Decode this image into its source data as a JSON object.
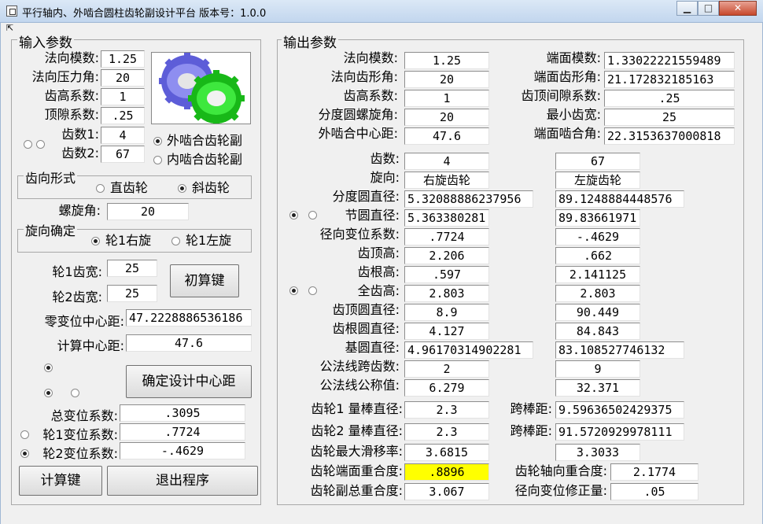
{
  "window": {
    "title": "平行轴内、外啮合圆柱齿轮副设计平台 版本号：1.0.0",
    "buttons": {
      "minimize": "▁",
      "maximize": "□",
      "close": "✕"
    }
  },
  "input": {
    "legend": "输入参数",
    "normal_module": {
      "label": "法向模数:",
      "value": "1.25"
    },
    "pressure_angle": {
      "label": "法向压力角:",
      "value": "20"
    },
    "addendum_coef": {
      "label": "齿高系数:",
      "value": "1"
    },
    "clearance_coef": {
      "label": "顶隙系数:",
      "value": ".25"
    },
    "teeth1": {
      "label": "齿数1:",
      "value": "4"
    },
    "teeth2": {
      "label": "齿数2:",
      "value": "67"
    },
    "mesh_external": "外啮合齿轮副",
    "mesh_internal": "内啮合齿轮副",
    "tooth_form_legend": "齿向形式",
    "spur": "直齿轮",
    "helical": "斜齿轮",
    "helix_angle": {
      "label": "螺旋角:",
      "value": "20"
    },
    "hand_legend": "旋向确定",
    "right_hand": "轮1右旋",
    "left_hand": "轮1左旋",
    "width1": {
      "label": "轮1齿宽:",
      "value": "25"
    },
    "width2": {
      "label": "轮2齿宽:",
      "value": "25"
    },
    "initial_button": "初算键",
    "zero_center": {
      "label": "零变位中心距:",
      "value": "47.2228886536186"
    },
    "calc_center": {
      "label": "计算中心距:",
      "value": "47.6"
    },
    "confirm_button": "确定设计中心距",
    "total_shift": {
      "label": "总变位系数:",
      "value": ".3095"
    },
    "shift1": {
      "label": "轮1变位系数:",
      "value": ".7724"
    },
    "shift2": {
      "label": "轮2变位系数:",
      "value": "-.4629"
    },
    "compute_button": "计算键",
    "exit_button": "退出程序"
  },
  "output": {
    "legend": "输出参数",
    "normal_module": {
      "label": "法向模数:",
      "value": "1.25"
    },
    "normal_profile_angle": {
      "label": "法向齿形角:",
      "value": "20"
    },
    "addendum_coef": {
      "label": "齿高系数:",
      "value": "1"
    },
    "helix_angle": {
      "label": "分度圆螺旋角:",
      "value": "20"
    },
    "center_distance": {
      "label": "外啮合中心距:",
      "value": "47.6"
    },
    "transverse_module": {
      "label": "端面模数:",
      "value": "1.33022221559489"
    },
    "transverse_profile_angle": {
      "label": "端面齿形角:",
      "value": "21.172832185163"
    },
    "tip_clearance_coef": {
      "label": "齿顶间隙系数:",
      "value": ".25"
    },
    "min_width": {
      "label": "最小齿宽:",
      "value": "25"
    },
    "transverse_mesh_angle": {
      "label": "端面啮合角:",
      "value": "22.3153637000818"
    },
    "rows": [
      {
        "label": "齿数:",
        "g1": "4",
        "g2": "67"
      },
      {
        "label": "旋向:",
        "g1": "右旋齿轮",
        "g2": "左旋齿轮"
      },
      {
        "label": "分度圆直径:",
        "g1": "5.32088886237956",
        "g2": "89.1248884448576"
      },
      {
        "label": "节圆直径:",
        "g1": "5.363380281",
        "g2": "89.83661971"
      },
      {
        "label": "径向变位系数:",
        "g1": ".7724",
        "g2": "-.4629"
      },
      {
        "label": "齿顶高:",
        "g1": "2.206",
        "g2": ".662"
      },
      {
        "label": "齿根高:",
        "g1": ".597",
        "g2": "2.141125"
      },
      {
        "label": "全齿高:",
        "g1": "2.803",
        "g2": "2.803"
      },
      {
        "label": "齿顶圆直径:",
        "g1": "8.9",
        "g2": "90.449"
      },
      {
        "label": "齿根圆直径:",
        "g1": "4.127",
        "g2": "84.843"
      },
      {
        "label": "基圆直径:",
        "g1": "4.96170314902281",
        "g2": "83.108527746132"
      },
      {
        "label": "公法线跨齿数:",
        "g1": "2",
        "g2": "9"
      },
      {
        "label": "公法线公称值:",
        "g1": "6.279",
        "g2": "32.371"
      }
    ],
    "gear1_pin": {
      "label": "齿轮1 量棒直径:",
      "value": "2.3"
    },
    "gear1_over_pins": {
      "label": "跨棒距:",
      "value": "9.59636502429375"
    },
    "gear2_pin": {
      "label": "齿轮2 量棒直径:",
      "value": "2.3"
    },
    "gear2_over_pins": {
      "label": "跨棒距:",
      "value": "91.5720929978111"
    },
    "max_slide": {
      "label": "齿轮最大滑移率:",
      "g1": "3.6815",
      "g2": "3.3033"
    },
    "transverse_contact": {
      "label": "齿轮端面重合度:",
      "value": ".8896"
    },
    "axial_contact": {
      "label": "齿轮轴向重合度:",
      "value": "2.1774"
    },
    "total_contact": {
      "label": "齿轮副总重合度:",
      "value": "3.067"
    },
    "radial_shift_corr": {
      "label": "径向变位修正量:",
      "value": ".05"
    }
  },
  "colors": {
    "highlight": "#ffff00",
    "gear_blue": "#6f6fe0",
    "gear_green": "#20d020"
  }
}
